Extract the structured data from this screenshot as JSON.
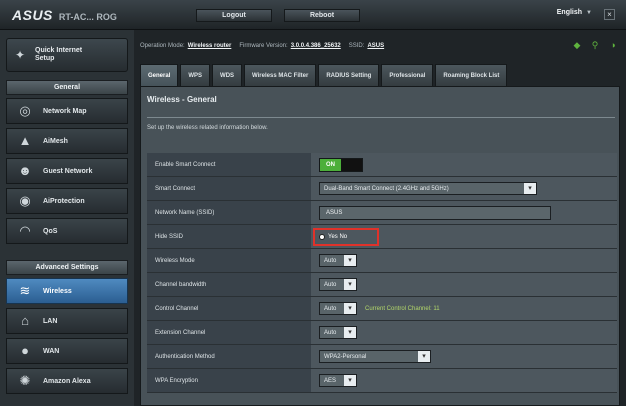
{
  "topbar": {
    "brand": "ASUS",
    "brand_sub": "RT-AC... ROG",
    "logout": "Logout",
    "reboot": "Reboot",
    "language": "English"
  },
  "sidebar": {
    "qis_label": "Quick Internet\nSetup",
    "general_header": "General",
    "general_items": [
      {
        "label": "Network Map",
        "icon": "network-map-icon"
      },
      {
        "label": "AiMesh",
        "icon": "aimesh-icon"
      },
      {
        "label": "Guest Network",
        "icon": "guest-network-icon"
      },
      {
        "label": "AiProtection",
        "icon": "shield-icon"
      },
      {
        "label": "QoS",
        "icon": "qos-icon"
      }
    ],
    "advanced_header": "Advanced Settings",
    "advanced_items": [
      {
        "label": "Wireless",
        "icon": "wireless-icon",
        "active": true
      },
      {
        "label": "LAN",
        "icon": "lan-icon",
        "active": false
      },
      {
        "label": "WAN",
        "icon": "wan-icon",
        "active": false
      },
      {
        "label": "Amazon Alexa",
        "icon": "alexa-icon",
        "active": false
      }
    ]
  },
  "status": {
    "op_mode_label": "Operation Mode:",
    "op_mode_value": "Wireless router",
    "firmware_label": "Firmware Version:",
    "firmware_value": "3.0.0.4.386_25632",
    "ssid_label": "SSID:",
    "ssid_value": "ASUS"
  },
  "tabs": [
    "General",
    "WPS",
    "WDS",
    "Wireless MAC Filter",
    "RADIUS Setting",
    "Professional",
    "Roaming Block List"
  ],
  "panel": {
    "title": "Wireless - General",
    "description": "Set up the wireless related information below.",
    "rows": [
      {
        "label": "Enable Smart Connect",
        "type": "toggle",
        "value": "ON"
      },
      {
        "label": "Smart Connect",
        "type": "select",
        "value": "Dual-Band Smart Connect (2.4GHz and 5GHz)"
      },
      {
        "label": "Network Name (SSID)",
        "type": "text",
        "value": "ASUS"
      },
      {
        "label": "Hide SSID",
        "type": "radio",
        "value": "Yes  No"
      },
      {
        "label": "Wireless Mode",
        "type": "select",
        "value": "Auto"
      },
      {
        "label": "Channel bandwidth",
        "type": "select",
        "value": "Auto"
      },
      {
        "label": "Control Channel",
        "type": "select",
        "value": "Auto",
        "hint": "Current Control Channel: 11"
      },
      {
        "label": "Extension Channel",
        "type": "select",
        "value": "Auto"
      },
      {
        "label": "Authentication Method",
        "type": "select",
        "value": "WPA2-Personal"
      },
      {
        "label": "WPA Encryption",
        "type": "select",
        "value": "AES"
      }
    ]
  }
}
